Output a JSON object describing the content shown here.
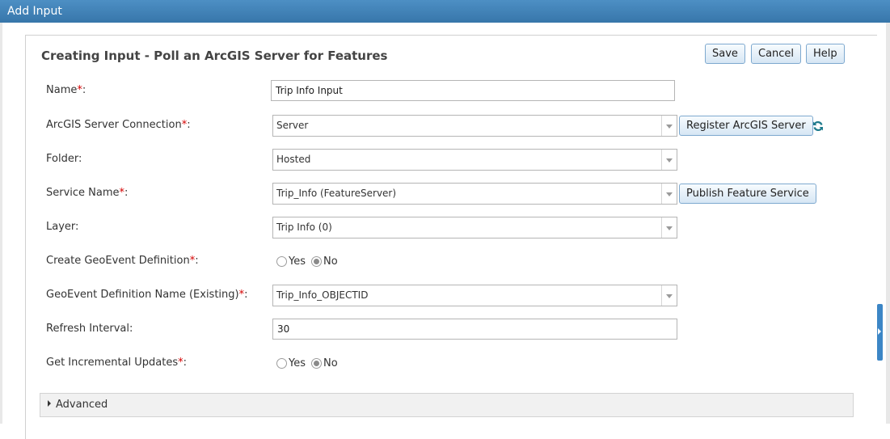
{
  "window": {
    "title": "Add Input"
  },
  "heading": "Creating Input - Poll an ArcGIS Server for Features",
  "toolbar": {
    "save_label": "Save",
    "cancel_label": "Cancel",
    "help_label": "Help"
  },
  "fields": {
    "name": {
      "label": "Name",
      "required": "*",
      "suffix": ":",
      "value": "Trip Info Input"
    },
    "connection": {
      "label": "ArcGIS Server Connection",
      "required": "*",
      "suffix": ":",
      "value": "Server",
      "button": "Register ArcGIS Server"
    },
    "folder": {
      "label": "Folder:",
      "value": "Hosted"
    },
    "service": {
      "label": "Service Name",
      "required": "*",
      "suffix": ":",
      "value": "Trip_Info (FeatureServer)",
      "button": "Publish Feature Service"
    },
    "layer": {
      "label": "Layer:",
      "value": "Trip Info (0)"
    },
    "create_def": {
      "label": "Create GeoEvent Definition",
      "required": "*",
      "suffix": ":",
      "yes": "Yes",
      "no": "No",
      "selected": "No"
    },
    "def_name": {
      "label": "GeoEvent Definition Name (Existing)",
      "required": "*",
      "suffix": ":",
      "value": "Trip_Info_OBJECTID"
    },
    "refresh": {
      "label": "Refresh Interval:",
      "value": "30"
    },
    "incremental": {
      "label": "Get Incremental Updates",
      "required": "*",
      "suffix": ":",
      "yes": "Yes",
      "no": "No",
      "selected": "No"
    }
  },
  "advanced": {
    "label": "Advanced"
  },
  "colors": {
    "titlebar": "#3d7fb5",
    "required": "#d40000",
    "button_border": "#7ea9cf"
  },
  "icons": {
    "refresh": "refresh-icon",
    "expand": "triangle-right-icon",
    "dropdown": "chevron-down-icon"
  }
}
